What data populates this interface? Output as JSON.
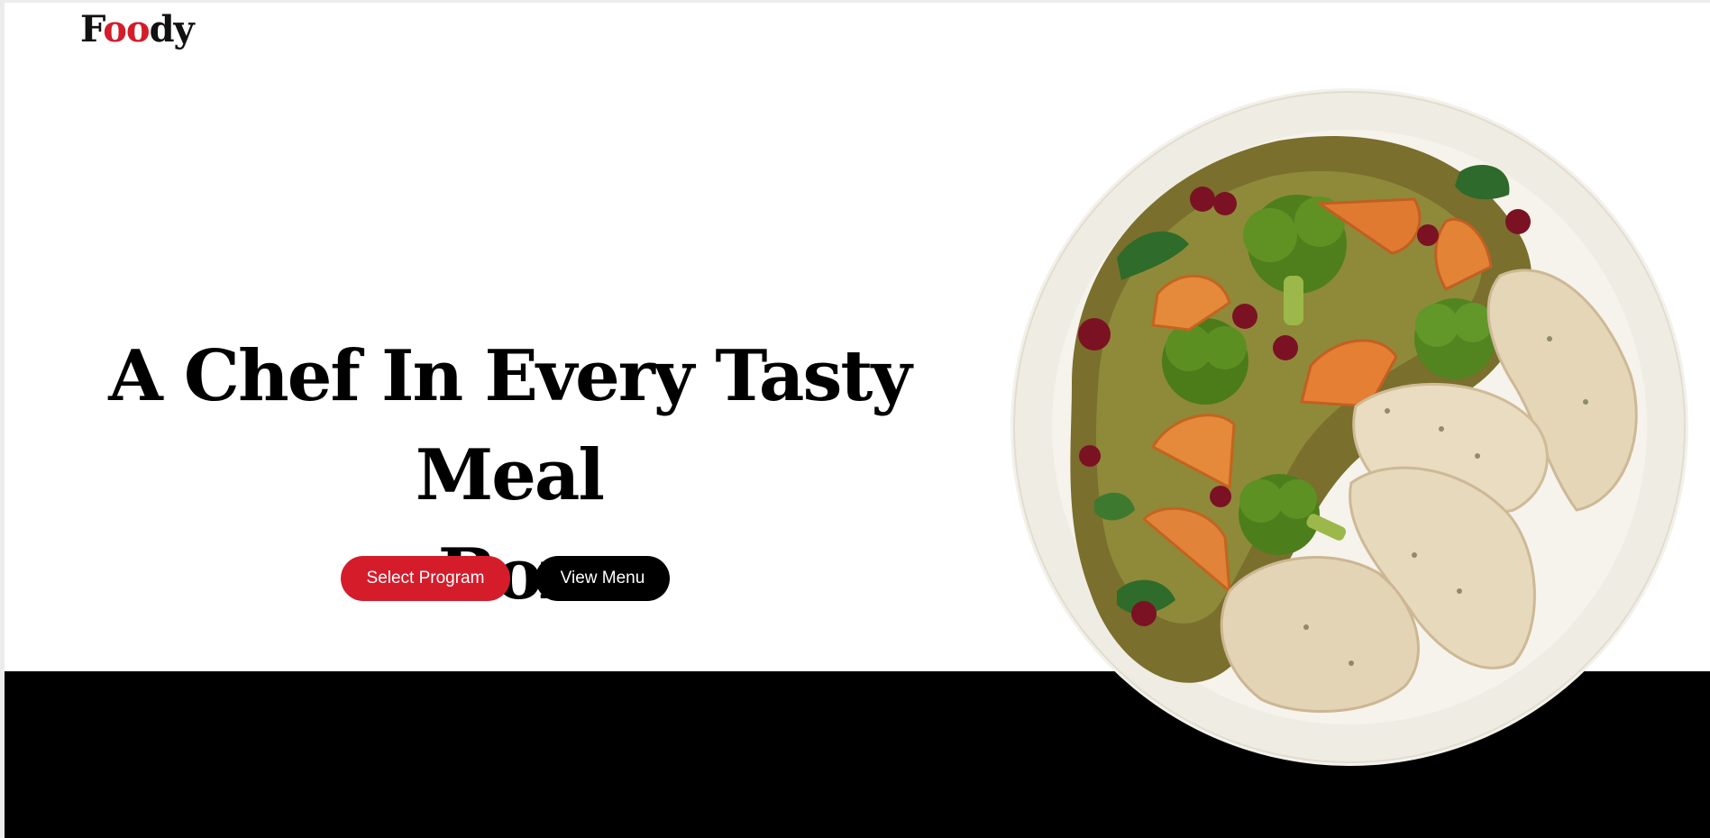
{
  "brand": {
    "logo_parts": [
      "F",
      "oo",
      "dy"
    ],
    "accent_color": "#d41c2b"
  },
  "hero": {
    "headline_line1": "A Chef In Every Tasty Meal",
    "headline_line2": "Box"
  },
  "actions": {
    "select_program_label": "Select Program",
    "view_menu_label": "View Menu"
  },
  "image": {
    "name": "meal-plate-image",
    "description_icon": "plate-with-chicken-broccoli-sweet-potato"
  }
}
